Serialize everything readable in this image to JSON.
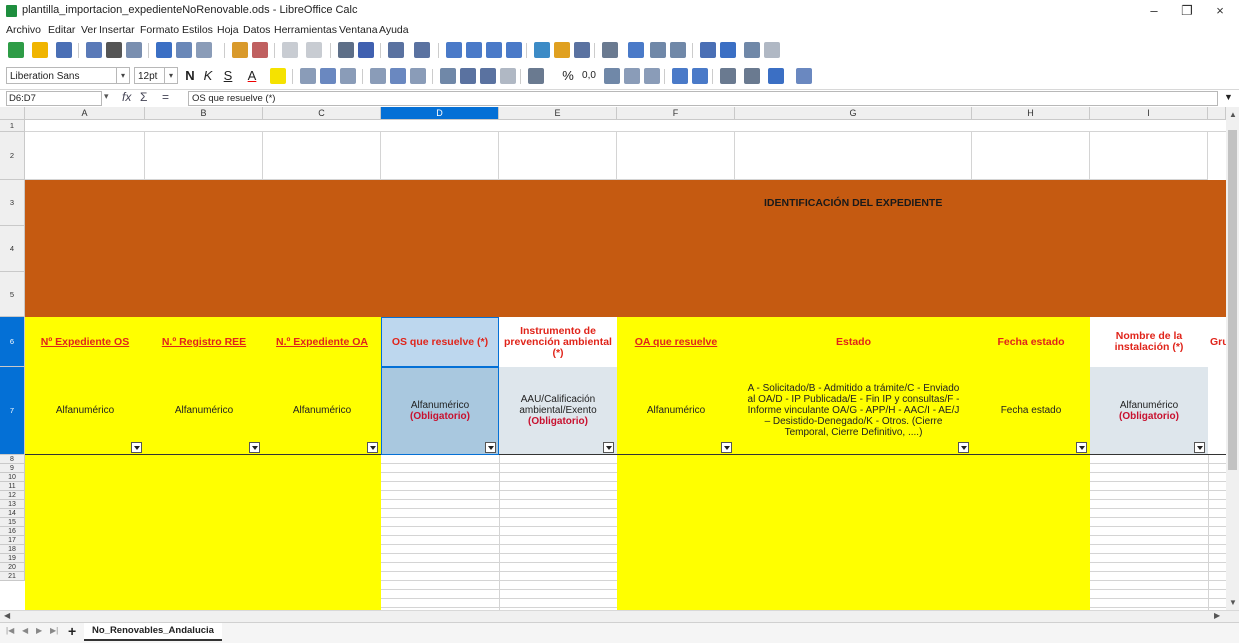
{
  "window": {
    "title": "plantilla_importacion_expedienteNoRenovable.ods - LibreOffice Calc",
    "minimize_glyph": "–",
    "maximize_glyph": "❐",
    "close_glyph": "×"
  },
  "menu": [
    "Archivo",
    "Editar",
    "Ver",
    "Insertar",
    "Formato",
    "Estilos",
    "Hoja",
    "Datos",
    "Herramientas",
    "Ventana",
    "Ayuda"
  ],
  "format_toolbar": {
    "font_name": "Liberation Sans",
    "font_size": "12pt",
    "bold": "N",
    "italic": "K",
    "underline": "S",
    "font_color_glyph": "A",
    "percent_glyph": "%",
    "decimal_glyph": "0,0"
  },
  "formula_bar": {
    "name_box": "D6:D7",
    "fx": "fx",
    "sum": "Σ",
    "equals": "=",
    "content": "OS que resuelve (*)"
  },
  "columns": [
    "A",
    "B",
    "C",
    "D",
    "E",
    "F",
    "G",
    "H",
    "I"
  ],
  "selected_column": "D",
  "rows_top": [
    "1",
    "2",
    "3",
    "4",
    "5",
    "6",
    "7"
  ],
  "rows_bottom": [
    "8",
    "9",
    "10",
    "11",
    "12",
    "13",
    "14",
    "15",
    "16",
    "17",
    "18",
    "19",
    "20",
    "21"
  ],
  "banner": {
    "text": "IDENTIFICACIÓN DEL EXPEDIENTE",
    "color": "#c55a11"
  },
  "headers": [
    "Nº Expediente OS",
    "N.º Registro REE",
    "N.º Expediente OA",
    "OS que resuelve (*)",
    "Instrumento de prevención ambiental (*)",
    "OA que resuelve",
    "Estado",
    "Fecha estado",
    "Nombre de la instalación (*)",
    "Gru"
  ],
  "types": {
    "a": "Alfanumérico",
    "b": "Alfanumérico",
    "c": "Alfanumérico",
    "d_main": "Alfanumérico",
    "d_obl": "(Obligatorio)",
    "e_main": "AAU/Calificación ambiental/Exento",
    "e_obl": "(Obligatorio)",
    "f": "Alfanumérico",
    "g": "A - Solicitado/B - Admitido a trámite/C - Enviado al OA/D - IP Publicada/E - Fin IP y consultas/F - Informe vinculante OA/G - APP/H - AAC/I - AE/J – Desistido-Denegado/K - Otros. (Cierre Temporal, Cierre Definitivo, ....)",
    "h": "Fecha estado",
    "i_main": "Alfanumérico",
    "i_obl": "(Obligatorio)"
  },
  "colors": {
    "yellow": "#ffff00",
    "banner": "#c55a11",
    "header_text": "#e0241a",
    "selected": "#bdd7ee",
    "gray_cell": "#dee6ec",
    "accent": "#0470d6"
  },
  "sheet_tab": "No_Renovables_Andalucia",
  "add_sheet": "+"
}
